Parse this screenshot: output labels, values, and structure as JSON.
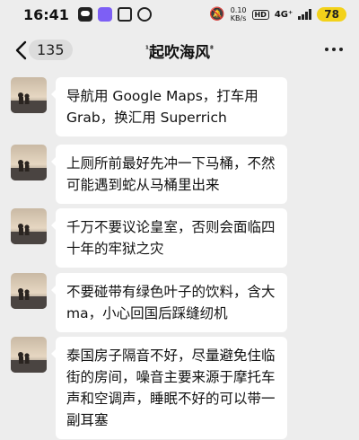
{
  "status_bar": {
    "time": "16:41",
    "net_speed_value": "0.10",
    "net_speed_unit": "KB/s",
    "hd_label": "HD",
    "network_type": "4G⁺",
    "battery": "78"
  },
  "nav": {
    "unread_count": "135",
    "title_prefix": "¹",
    "title": "起吹海风",
    "title_suffix": "⁸"
  },
  "messages": [
    {
      "text": "导航用 Google Maps，打车用 Grab，换汇用 Superrich"
    },
    {
      "text": "上厕所前最好先冲一下马桶，不然可能遇到蛇从马桶里出来"
    },
    {
      "text": "千万不要议论皇室，否则会面临四十年的牢狱之灾"
    },
    {
      "text": "不要碰带有绿色叶子的饮料，含大ma，小心回国后踩缝纫机"
    },
    {
      "text": "泰国房子隔音不好，尽量避免住临街的房间，噪音主要来源于摩托车声和空调声，睡眠不好的可以带一副耳塞"
    }
  ]
}
